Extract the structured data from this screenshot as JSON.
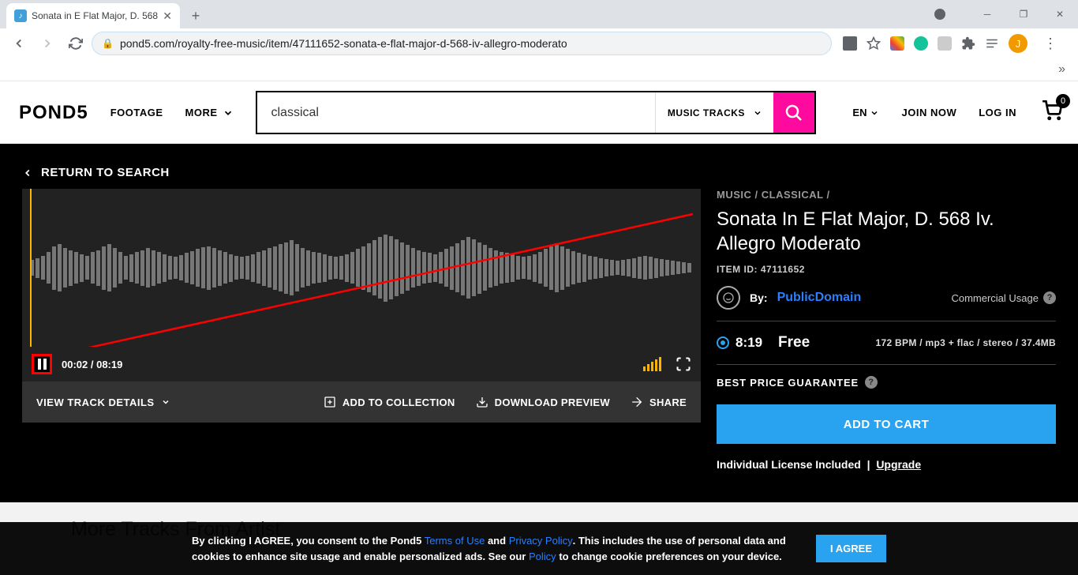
{
  "browser": {
    "tab_title": "Sonata in E Flat Major, D. 568",
    "url": "pond5.com/royalty-free-music/item/47111652-sonata-e-flat-major-d-568-iv-allegro-moderato",
    "avatar_initial": "J"
  },
  "header": {
    "logo": "POND5",
    "nav_footage": "FOOTAGE",
    "nav_more": "MORE",
    "search_value": "classical",
    "search_category": "MUSIC TRACKS",
    "lang": "EN",
    "join": "JOIN NOW",
    "login": "LOG IN",
    "cart_count": "0"
  },
  "content": {
    "return": "RETURN TO SEARCH",
    "time_current": "00:02",
    "time_total": "08:19",
    "view_details": "VIEW TRACK DETAILS",
    "add_collection": "ADD TO COLLECTION",
    "download_preview": "DOWNLOAD PREVIEW",
    "share": "SHARE"
  },
  "info": {
    "crumb_music": "MUSIC",
    "crumb_classical": "CLASSICAL",
    "title": "Sonata In E Flat Major, D. 568 Iv. Allegro Moderato",
    "item_id_label": "ITEM ID:",
    "item_id": "47111652",
    "by": "By:",
    "author": "PublicDomain",
    "usage": "Commercial Usage",
    "duration": "8:19",
    "price": "Free",
    "format": "172 BPM / mp3 + flac / stereo / 37.4MB",
    "guarantee": "BEST PRICE GUARANTEE",
    "add_cart": "ADD TO CART",
    "license": "Individual License Included",
    "upgrade": "Upgrade"
  },
  "more": {
    "title": "More Tracks From Artist"
  },
  "cookie": {
    "prefix": "By clicking I AGREE, you consent to the Pond5",
    "terms": "Terms of Use",
    "and": "and",
    "privacy": "Privacy Policy",
    "middle": ". This includes the use of personal data and cookies to enhance site usage and enable personalized ads. See our",
    "policy": "Policy",
    "suffix": "to change cookie preferences on your device.",
    "agree": "I AGREE"
  }
}
